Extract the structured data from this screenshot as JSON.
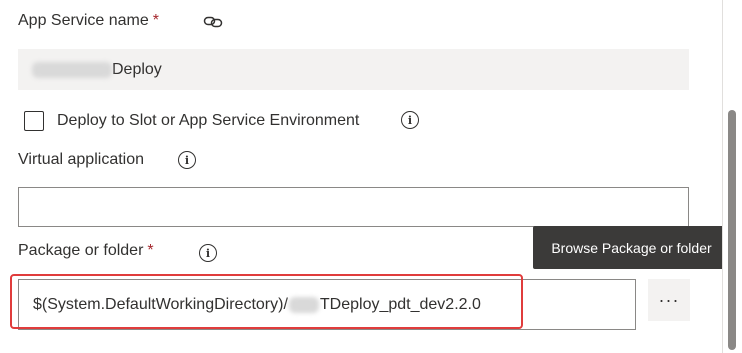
{
  "app_service": {
    "label": "App Service name",
    "required_mark": "*",
    "value_suffix": "Deploy"
  },
  "deploy_slot": {
    "label": "Deploy to Slot or App Service Environment",
    "checked": false
  },
  "virtual_app": {
    "label": "Virtual application",
    "value": ""
  },
  "package": {
    "label": "Package or folder",
    "required_mark": "*",
    "value_prefix": "$(System.DefaultWorkingDirectory)/",
    "value_suffix": "TDeploy_pdt_dev2.2.0",
    "browse_label": "···",
    "tooltip": "Browse Package or folder"
  },
  "icons": {
    "link": "link-icon",
    "info": "info-icon",
    "more": "ellipsis-icon"
  },
  "colors": {
    "required": "#a4262c",
    "highlight": "#e03c3c",
    "tooltip_bg": "#3b3a39"
  }
}
